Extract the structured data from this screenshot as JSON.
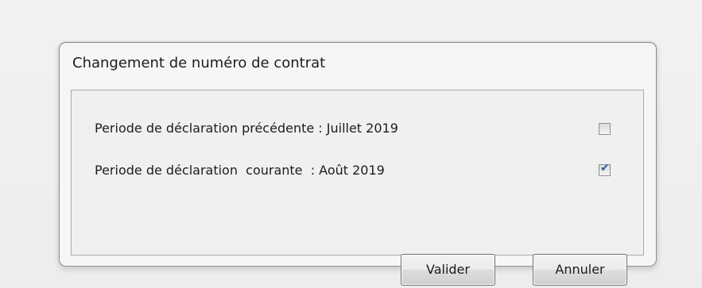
{
  "dialog": {
    "title": "Changement de numéro de contrat",
    "rows": [
      {
        "label": "Periode de déclaration précédente : Juillet 2019",
        "checked": false
      },
      {
        "label": "Periode de déclaration  courante  : Août 2019",
        "checked": true
      }
    ],
    "buttons": {
      "validate_label": "Valider",
      "cancel_label": "Annuler"
    }
  }
}
